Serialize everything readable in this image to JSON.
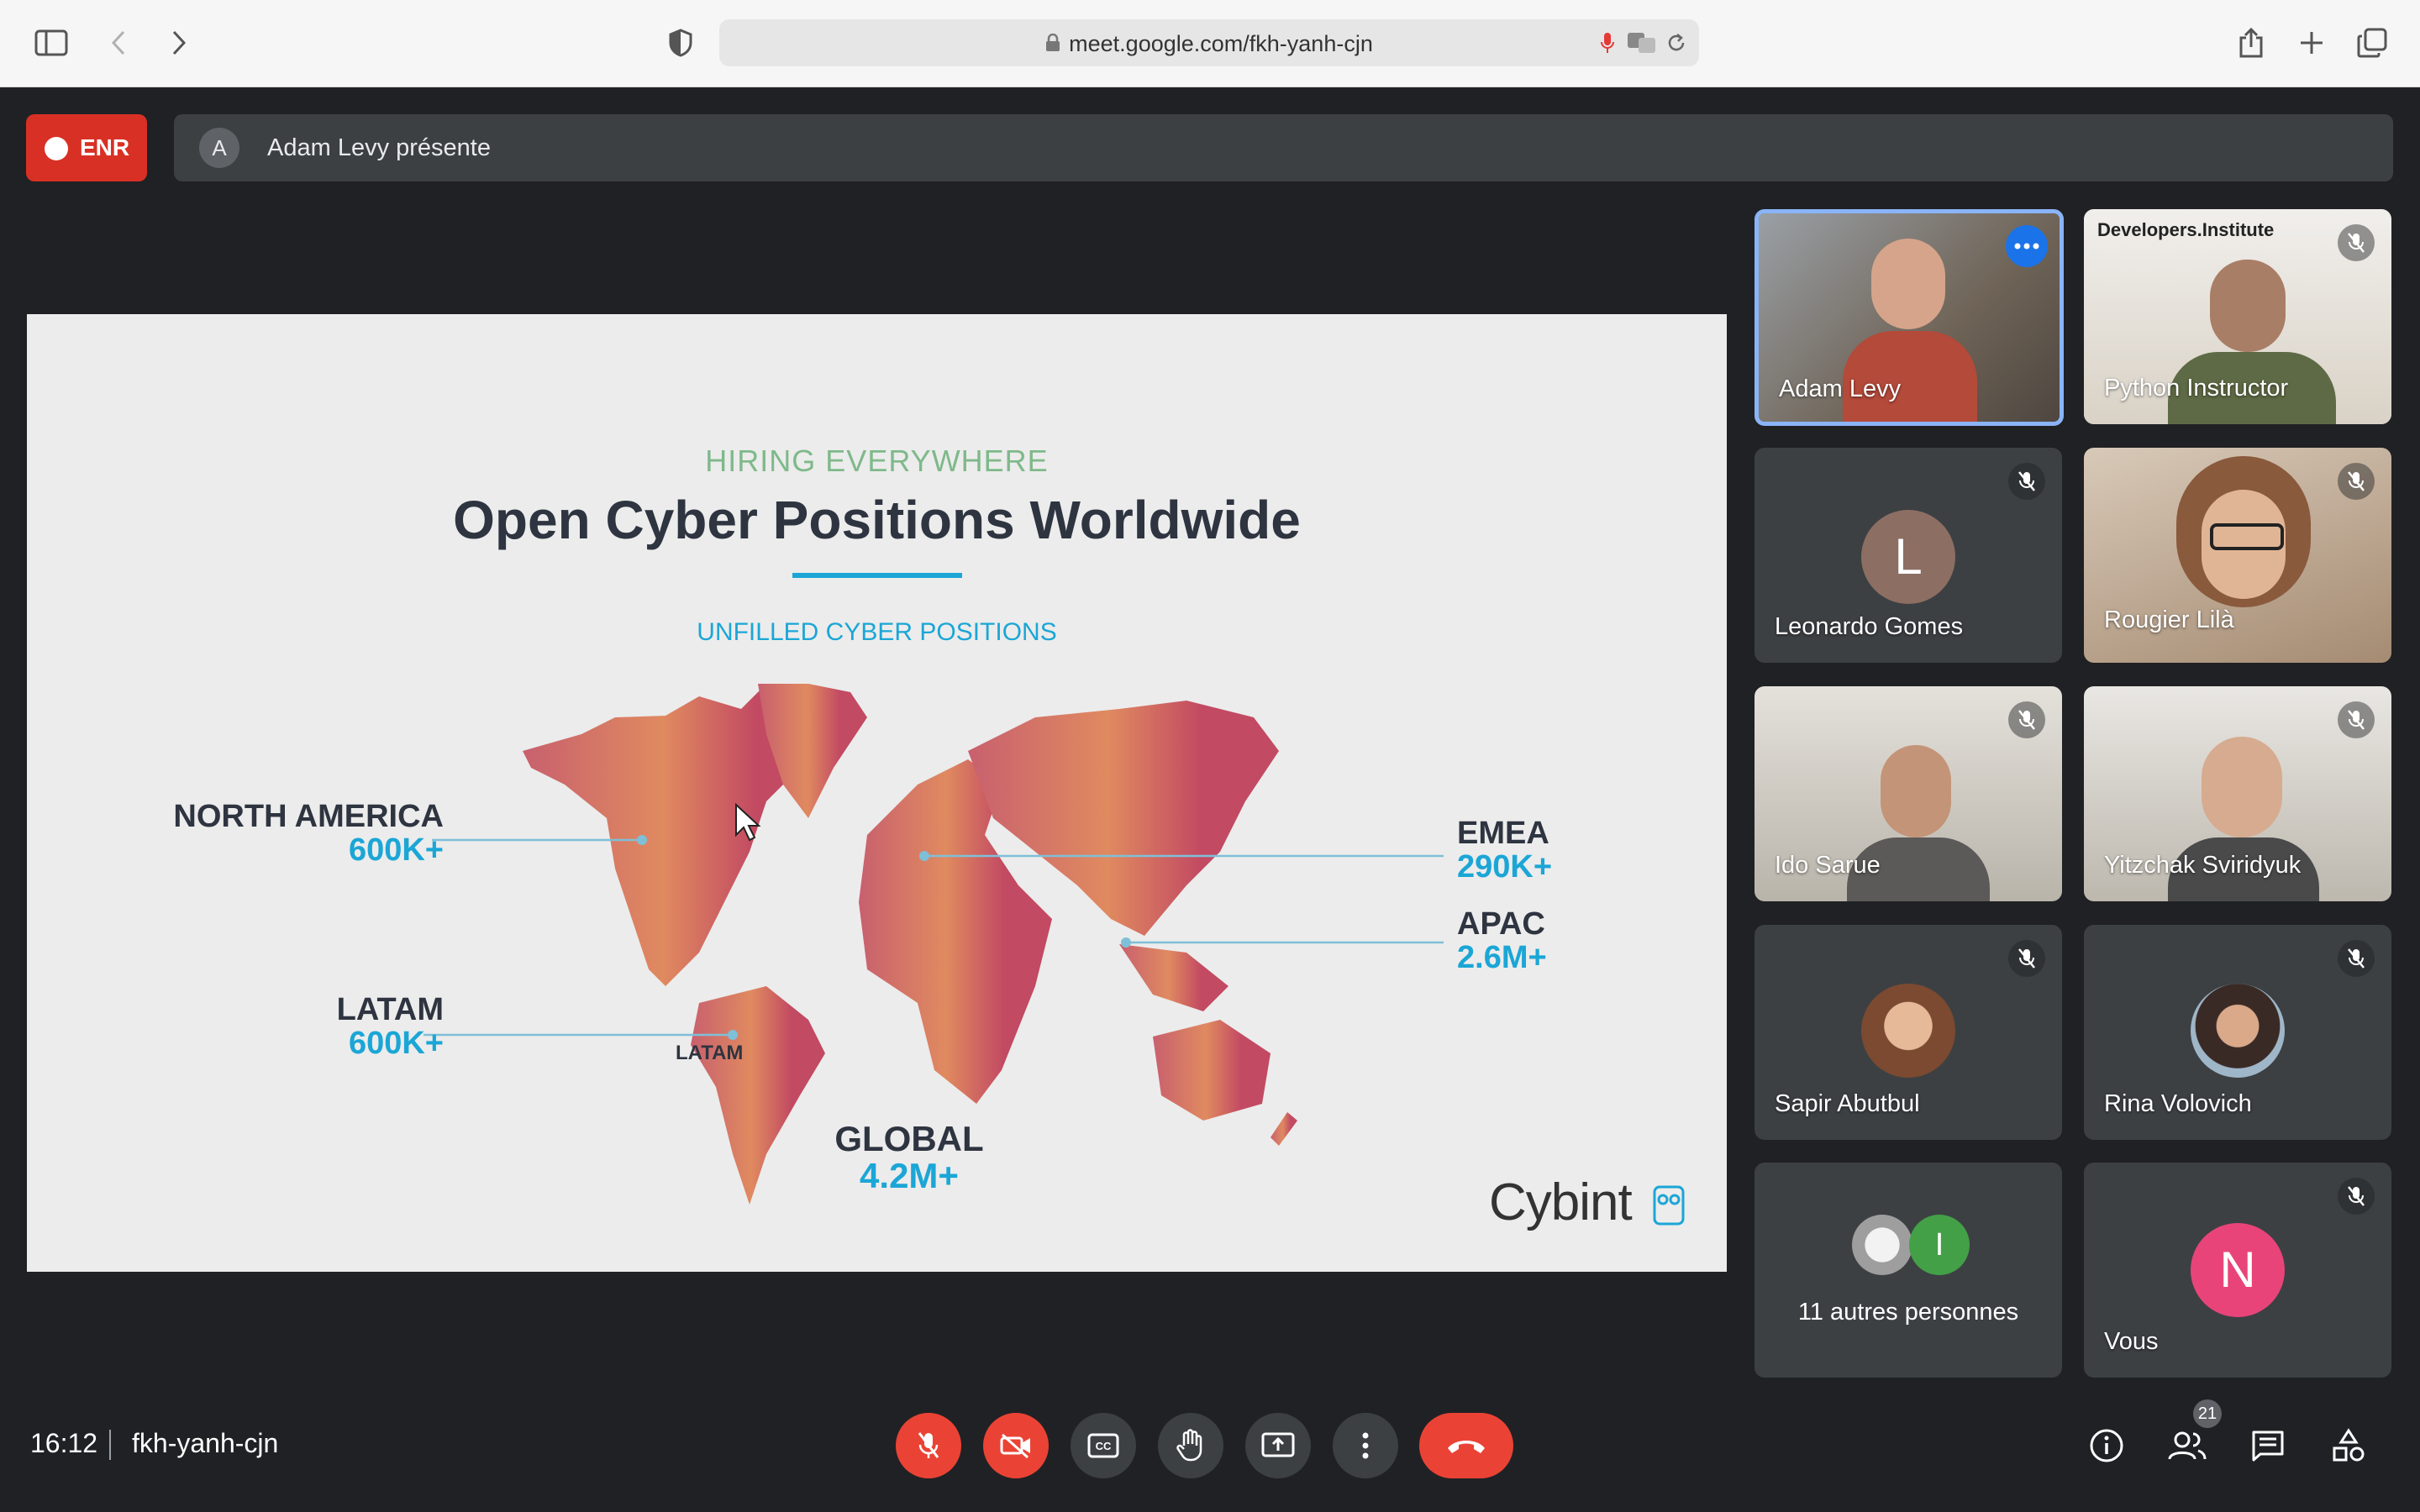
{
  "browser": {
    "url": "meet.google.com/fkh-yanh-cjn"
  },
  "meeting": {
    "recording_label": "ENR",
    "presenter_initial": "A",
    "presenter_text": "Adam Levy présente",
    "time": "16:12",
    "code": "fkh-yanh-cjn",
    "participant_count": "21"
  },
  "slide": {
    "kicker": "HIRING EVERYWHERE",
    "title": "Open Cyber Positions Worldwide",
    "subtitle": "UNFILLED CYBER POSITIONS",
    "regions": [
      {
        "name": "NORTH AMERICA",
        "value": "600K+"
      },
      {
        "name": "LATAM",
        "value": "600K+"
      },
      {
        "name": "EMEA",
        "value": "290K+"
      },
      {
        "name": "APAC",
        "value": "2.6M+"
      },
      {
        "name": "GLOBAL",
        "value": "4.2M+"
      }
    ],
    "map_label": "LATAM",
    "brand": "Cybint",
    "colors": {
      "title": "#2e3440",
      "kicker": "#7fb98a",
      "accent": "#1ba6d6"
    }
  },
  "participants": [
    {
      "name": "Adam Levy",
      "kind": "video",
      "active": true
    },
    {
      "name": "Python Instructor",
      "kind": "video",
      "overlay": "Developers.Institute"
    },
    {
      "name": "Leonardo Gomes",
      "kind": "avatar",
      "initial": "L",
      "color": "#8d6e63"
    },
    {
      "name": "Rougier Lilà",
      "kind": "video"
    },
    {
      "name": "Ido Sarue",
      "kind": "video"
    },
    {
      "name": "Yitzchak Sviridyuk",
      "kind": "video"
    },
    {
      "name": "Sapir Abutbul",
      "kind": "photo"
    },
    {
      "name": "Rina Volovich",
      "kind": "photo"
    },
    {
      "name": "11 autres personnes",
      "kind": "group",
      "initial": "I"
    },
    {
      "name": "Vous",
      "kind": "avatar",
      "initial": "N",
      "color": "#e8447a"
    }
  ]
}
